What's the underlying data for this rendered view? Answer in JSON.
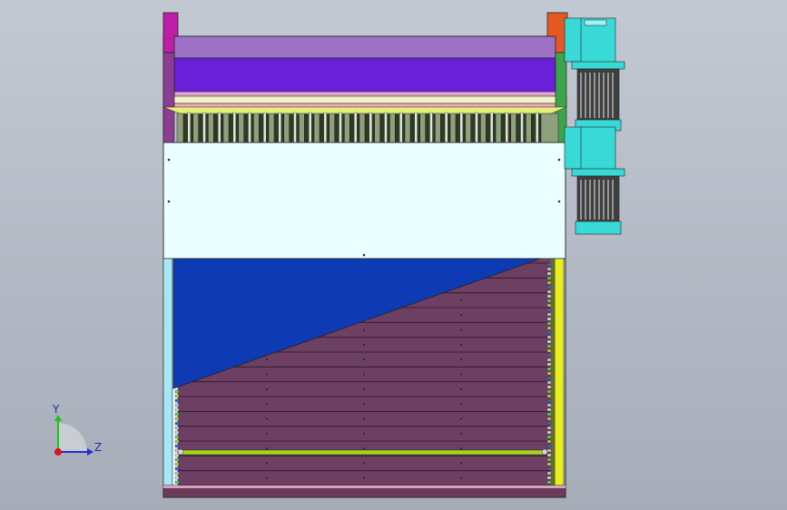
{
  "viewport": {
    "background": "#b8bec9"
  },
  "triad": {
    "y_label": "Y",
    "z_label": "Z",
    "y_color": "#19c11d",
    "z_color": "#1d2fd8",
    "x_color": "#d8141b"
  },
  "model": {
    "frame_color": "#6b3b5a",
    "roller_top_color": "#9d72c6",
    "roller_body_color": "#6a20d8",
    "hopper_color": "#eaffff",
    "blue_panel_color": "#0e3bb4",
    "slat_color": "#6d3f62",
    "motor_color": "#38d9d6",
    "rail_color": "#e7ef21",
    "bar_color": "#a6d61a",
    "left_flange_color": "#c01da8",
    "right_flange_color": "#e45a22",
    "left_post_color": "#a7e6f4",
    "teeth_count": 24,
    "slat_count": 15
  }
}
